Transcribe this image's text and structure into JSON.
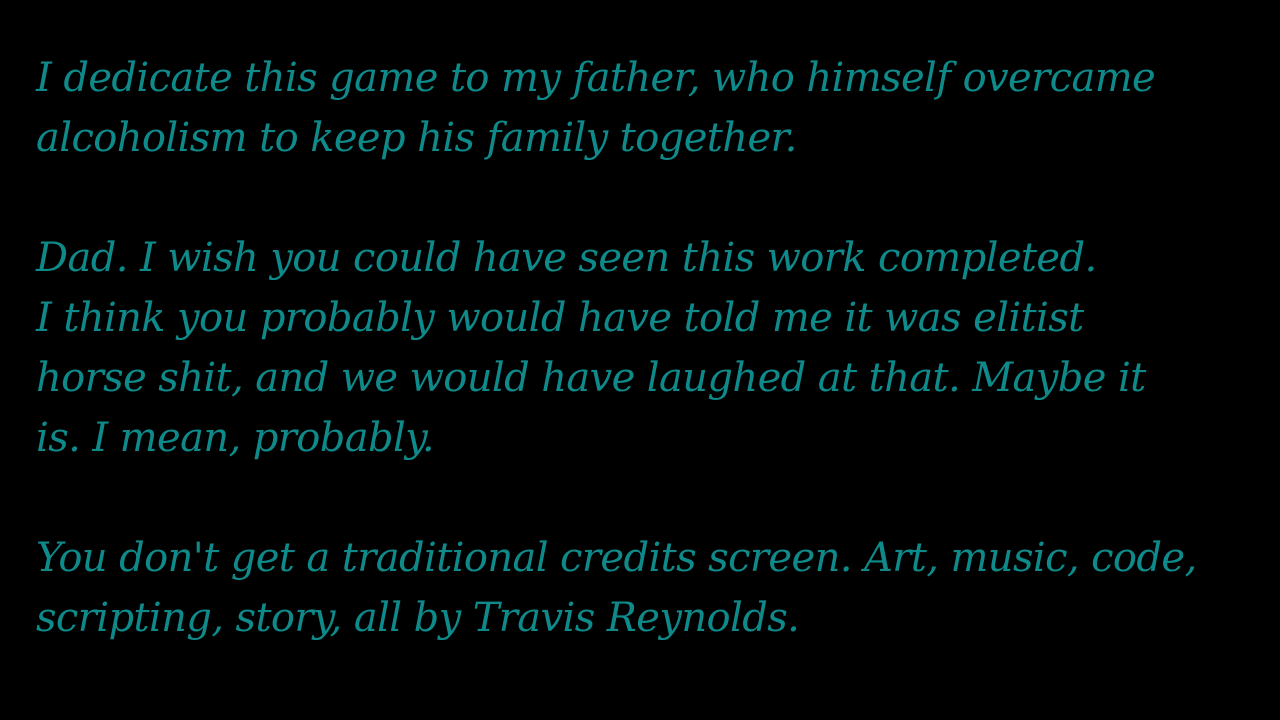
{
  "screen": {
    "text_color": "#0f8a8a",
    "background_color": "#000000"
  },
  "dedication": {
    "lines": [
      "I dedicate this game to my father, who himself overcame",
      "alcoholism to keep his family together.",
      "",
      "Dad. I wish you could have seen this work completed.",
      "I think you probably would have told me it was elitist",
      "horse shit, and we would have laughed at that. Maybe it",
      "is. I mean, probably.",
      "",
      "You don't get a traditional credits screen. Art, music, code,",
      "scripting, story, all by Travis Reynolds."
    ]
  }
}
